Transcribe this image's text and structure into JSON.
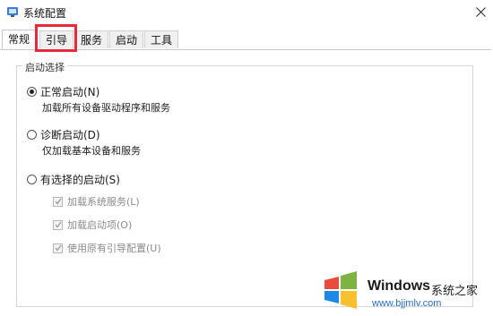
{
  "window": {
    "title": "系统配置"
  },
  "tabs": [
    {
      "label": "常规"
    },
    {
      "label": "引导"
    },
    {
      "label": "服务"
    },
    {
      "label": "启动"
    },
    {
      "label": "工具"
    }
  ],
  "group": {
    "title": "启动选择"
  },
  "options": [
    {
      "label": "正常启动(N)",
      "desc": "加载所有设备驱动程序和服务",
      "checked": true
    },
    {
      "label": "诊断启动(D)",
      "desc": "仅加载基本设备和服务",
      "checked": false
    },
    {
      "label": "有选择的启动(S)",
      "checked": false
    }
  ],
  "sub_options": [
    {
      "label": "加载系统服务(L)",
      "checked": true,
      "enabled": false
    },
    {
      "label": "加载启动项(O)",
      "checked": true,
      "enabled": false
    },
    {
      "label": "使用原有引导配置(U)",
      "checked": true,
      "enabled": false
    }
  ],
  "watermark": {
    "title": "Windows",
    "subtitle": "系统之家",
    "url": "www.bjjmlv.com"
  },
  "colors": {
    "highlight": "#e8293a",
    "windows_logo": [
      "#e74c3c",
      "#7cb342",
      "#1e88e5",
      "#fbc02d"
    ]
  }
}
